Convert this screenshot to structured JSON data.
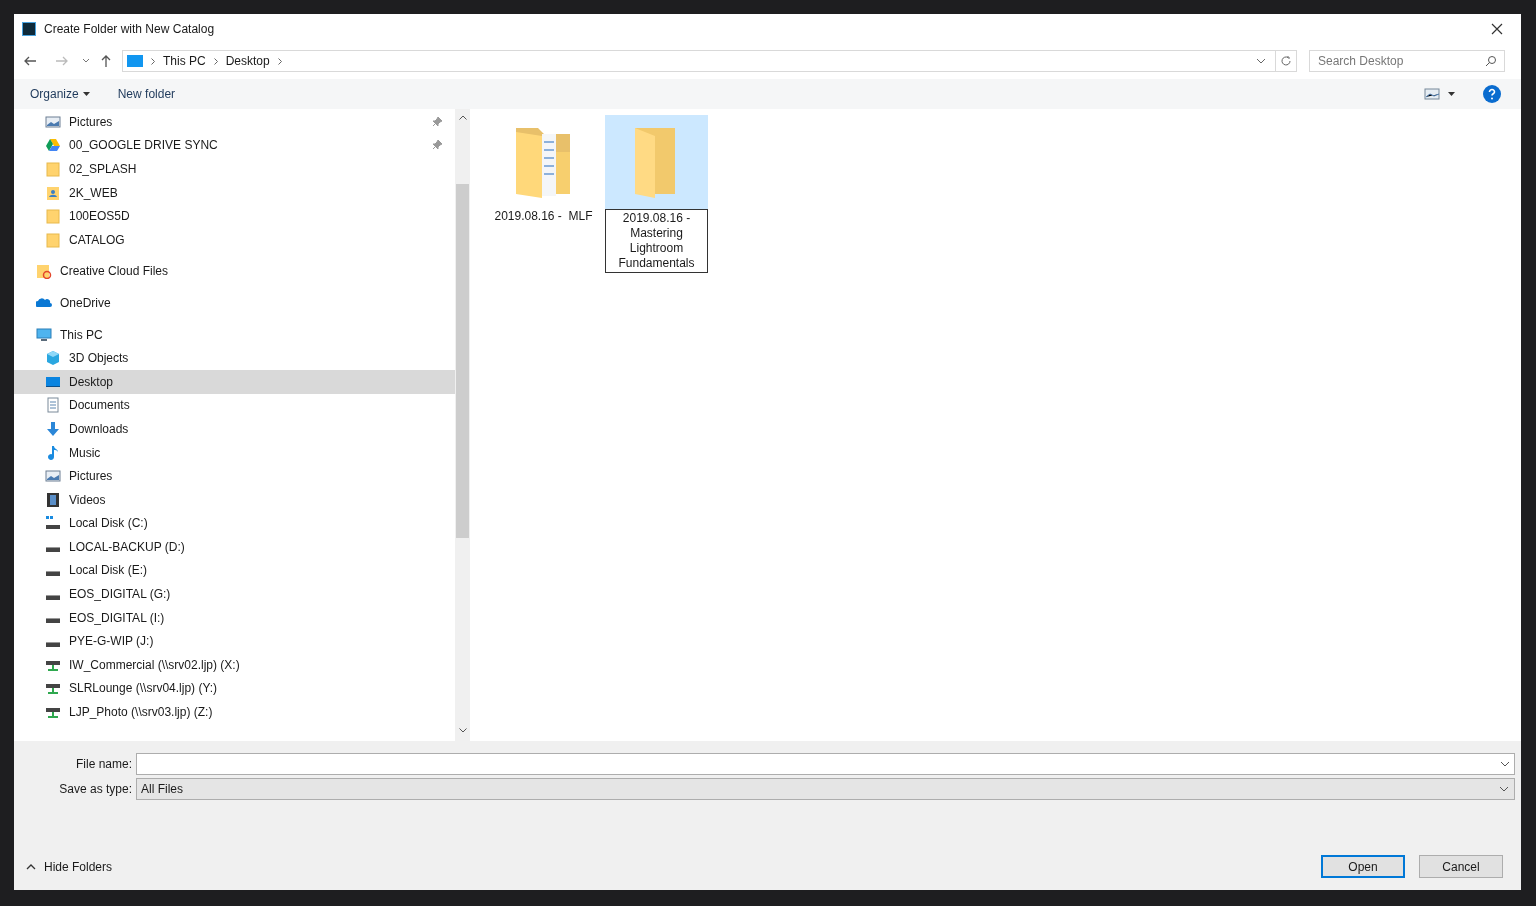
{
  "window": {
    "title": "Create Folder with New Catalog"
  },
  "address": {
    "crumbs": [
      "This PC",
      "Desktop"
    ]
  },
  "search": {
    "placeholder": "Search Desktop"
  },
  "toolbar": {
    "organize": "Organize",
    "new_folder": "New folder"
  },
  "sidebar": {
    "groups": [
      {
        "children": [
          {
            "label": "Pictures",
            "kind": "pictures",
            "pinned": true,
            "selected": false
          },
          {
            "label": "00_GOOGLE DRIVE SYNC",
            "kind": "gdrive",
            "pinned": true,
            "selected": false
          },
          {
            "label": "02_SPLASH",
            "kind": "folder",
            "pinned": false,
            "selected": false
          },
          {
            "label": "2K_WEB",
            "kind": "userfolder",
            "pinned": false,
            "selected": false
          },
          {
            "label": "100EOS5D",
            "kind": "folder",
            "pinned": false,
            "selected": false
          },
          {
            "label": "CATALOG",
            "kind": "folder",
            "pinned": false,
            "selected": false
          }
        ]
      },
      {
        "label": "Creative Cloud Files",
        "kind": "cc",
        "selected": false
      },
      {
        "label": "OneDrive",
        "kind": "onedrive",
        "selected": false
      },
      {
        "label": "This PC",
        "kind": "pc",
        "selected": false,
        "children": [
          {
            "label": "3D Objects",
            "kind": "cube",
            "pinned": false,
            "selected": false
          },
          {
            "label": "Desktop",
            "kind": "desktop",
            "pinned": false,
            "selected": true
          },
          {
            "label": "Documents",
            "kind": "documents",
            "pinned": false,
            "selected": false
          },
          {
            "label": "Downloads",
            "kind": "downloads",
            "pinned": false,
            "selected": false
          },
          {
            "label": "Music",
            "kind": "music",
            "pinned": false,
            "selected": false
          },
          {
            "label": "Pictures",
            "kind": "pictures",
            "pinned": false,
            "selected": false
          },
          {
            "label": "Videos",
            "kind": "videos",
            "pinned": false,
            "selected": false
          },
          {
            "label": "Local Disk (C:)",
            "kind": "osdisk",
            "pinned": false,
            "selected": false
          },
          {
            "label": "LOCAL-BACKUP (D:)",
            "kind": "disk",
            "pinned": false,
            "selected": false
          },
          {
            "label": "Local Disk (E:)",
            "kind": "disk",
            "pinned": false,
            "selected": false
          },
          {
            "label": "EOS_DIGITAL (G:)",
            "kind": "disk",
            "pinned": false,
            "selected": false
          },
          {
            "label": "EOS_DIGITAL (I:)",
            "kind": "disk",
            "pinned": false,
            "selected": false
          },
          {
            "label": "PYE-G-WIP (J:)",
            "kind": "disk",
            "pinned": false,
            "selected": false
          },
          {
            "label": "IW_Commercial (\\\\srv02.ljp) (X:)",
            "kind": "network",
            "pinned": false,
            "selected": false
          },
          {
            "label": "SLRLounge (\\\\srv04.ljp) (Y:)",
            "kind": "network",
            "pinned": false,
            "selected": false
          },
          {
            "label": "LJP_Photo (\\\\srv03.ljp) (Z:)",
            "kind": "network",
            "pinned": false,
            "selected": false
          }
        ]
      }
    ]
  },
  "files": [
    {
      "name": "2019.08.16 -  MLF",
      "kind": "documents",
      "selected": false,
      "renaming": false
    },
    {
      "name": "2019.08.16 - Mastering Lightroom Fundamentals",
      "kind": "empty",
      "selected": true,
      "renaming": true
    }
  ],
  "form": {
    "file_name_label": "File name:",
    "type_label": "Save as type:",
    "type_value": "All Files"
  },
  "footer": {
    "hide_folders": "Hide Folders",
    "open": "Open",
    "cancel": "Cancel"
  }
}
